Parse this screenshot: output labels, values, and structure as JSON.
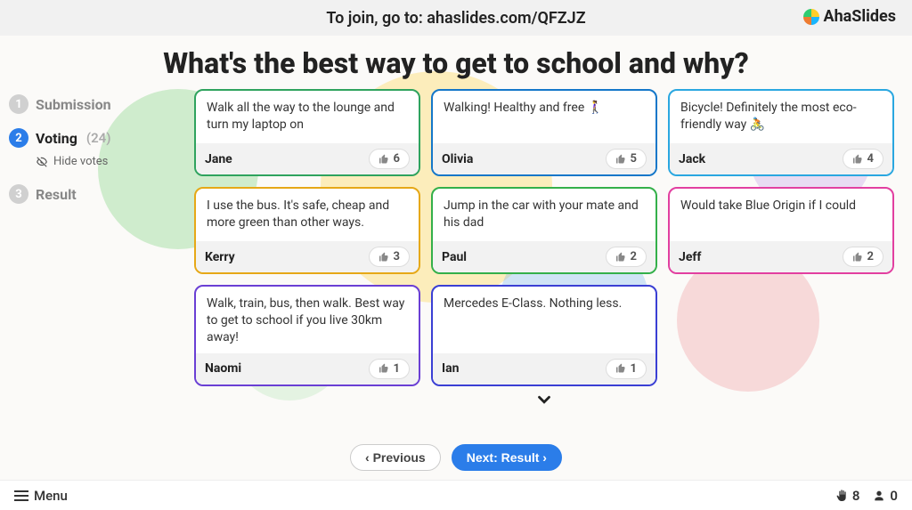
{
  "topbar": {
    "join_text": "To join, go to: ahaslides.com/QFZJZ",
    "brand": "AhaSlides"
  },
  "question": "What's the best way to get to school and why?",
  "steps": {
    "submission": {
      "num": "1",
      "label": "Submission"
    },
    "voting": {
      "num": "2",
      "label": "Voting",
      "count": "(24)"
    },
    "result": {
      "num": "3",
      "label": "Result"
    },
    "hide_votes_label": "Hide votes"
  },
  "cards": [
    {
      "text": "Walk all the way to the lounge and turn my laptop on",
      "author": "Jane",
      "votes": "6",
      "color": "#2fa35e"
    },
    {
      "text": "Walking! Healthy and free 🚶‍♀️",
      "author": "Olivia",
      "votes": "5",
      "color": "#1477c9"
    },
    {
      "text": "Bicycle! Definitely the most eco-friendly way 🚴",
      "author": "Jack",
      "votes": "4",
      "color": "#2aa7e0"
    },
    {
      "text": "I use the bus. It's safe, cheap and more green than other ways.",
      "author": "Kerry",
      "votes": "3",
      "color": "#e6a817"
    },
    {
      "text": "Jump in the car with your mate and his dad",
      "author": "Paul",
      "votes": "2",
      "color": "#34b04a"
    },
    {
      "text": "Would take Blue Origin if I could",
      "author": "Jeff",
      "votes": "2",
      "color": "#e23fa0"
    },
    {
      "text": "Walk, train, bus, then walk. Best way to get to school if you live 30km away!",
      "author": "Naomi",
      "votes": "1",
      "color": "#6a3fd4"
    },
    {
      "text": "Mercedes E-Class. Nothing less.",
      "author": "Ian",
      "votes": "1",
      "color": "#3a3fd4"
    }
  ],
  "nav": {
    "prev": "‹ Previous",
    "next": "Next: Result ›"
  },
  "bottombar": {
    "menu": "Menu",
    "raised": "8",
    "participants": "0"
  }
}
